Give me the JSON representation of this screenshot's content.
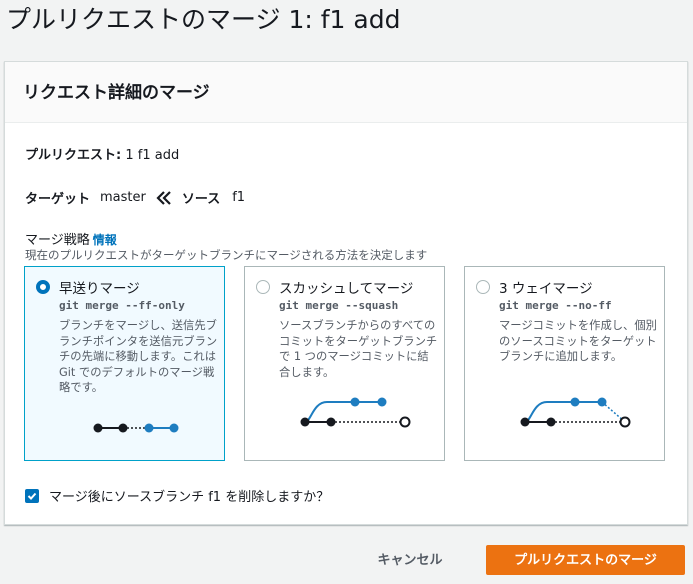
{
  "page": {
    "title": "プルリクエストのマージ 1: f1 add"
  },
  "panel": {
    "header": "リクエスト詳細のマージ",
    "pull_request_label": "プルリクエスト:",
    "pull_request_value": "1 f1 add",
    "target_label": "ターゲット",
    "target_value": "master",
    "source_label": "ソース",
    "source_value": "f1",
    "strategy_label": "マージ戦略",
    "info_link": "情報",
    "strategy_description": "現在のプルリクエストがターゲットブランチにマージされる方法を決定します",
    "options": [
      {
        "title": "早送りマージ",
        "command": "git merge --ff-only",
        "description": "ブランチをマージし、送信先ブランチポインタを送信元ブランチの先端に移動します。これは Git でのデフォルトのマージ戦略です。",
        "selected": true
      },
      {
        "title": "スカッシュしてマージ",
        "command": "git merge --squash",
        "description": "ソースブランチからのすべてのコミットをターゲットブランチで 1 つのマージコミットに結合します。",
        "selected": false
      },
      {
        "title": "3 ウェイマージ",
        "command": "git merge --no-ff",
        "description": "マージコミットを作成し、個別のソースコミットをターゲットブランチに追加します。",
        "selected": false
      }
    ],
    "delete_branch_label": "マージ後にソースブランチ f1 を削除しますか？",
    "delete_branch_checked": true
  },
  "footer": {
    "cancel_label": "キャンセル",
    "merge_label": "プルリクエストのマージ"
  },
  "colors": {
    "primary_button": "#ec7211",
    "link": "#0073bb",
    "selected_border": "#00a1c9",
    "selected_bg": "#f1faff",
    "graph_blue": "#1e7dc0",
    "graph_black": "#16191f"
  }
}
